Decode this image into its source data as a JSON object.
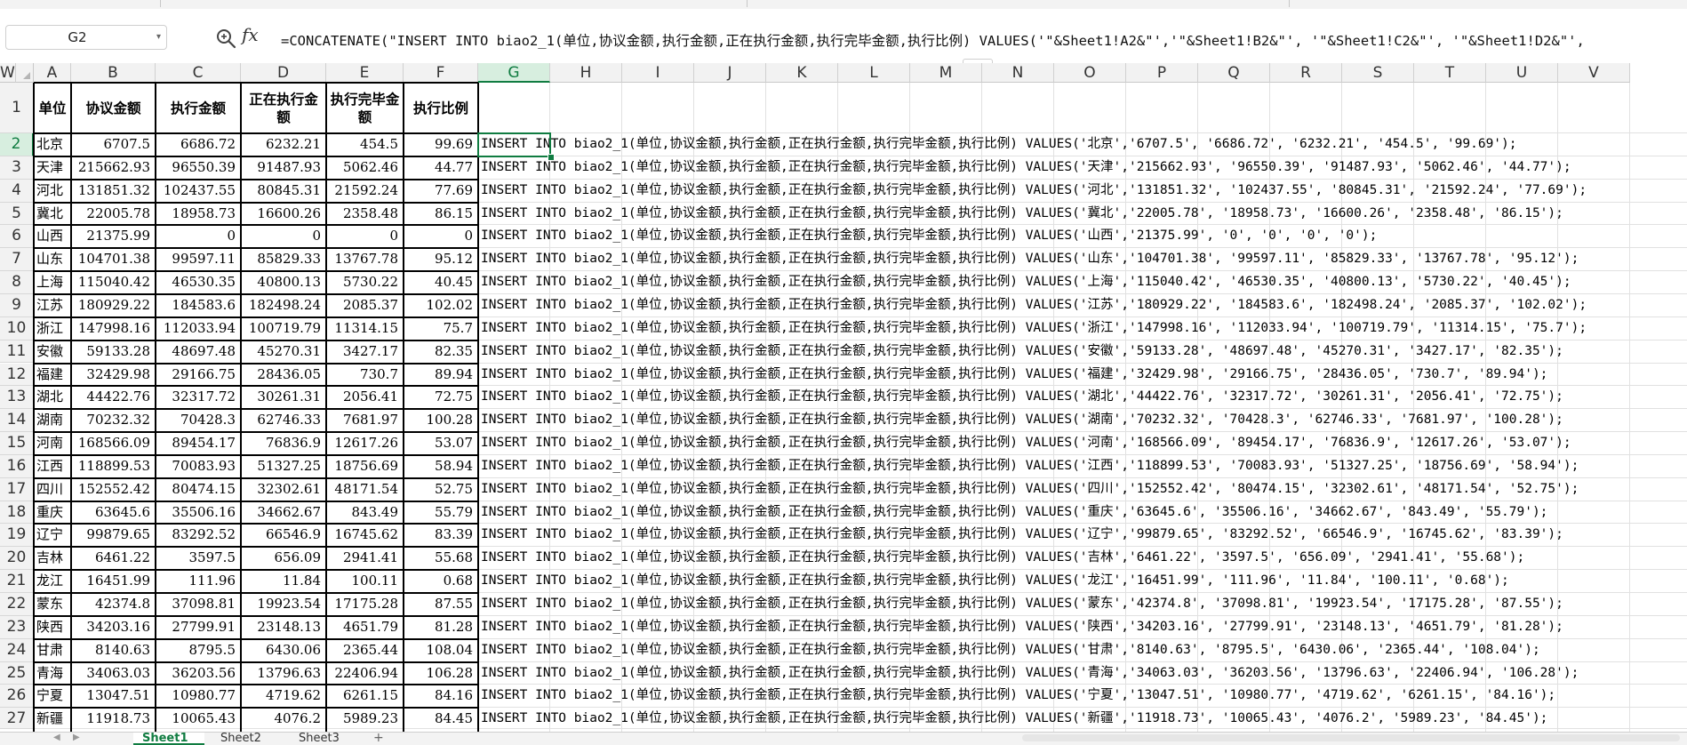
{
  "formula_bar": {
    "name_box": "G2",
    "fx_label": "fx",
    "formula": "=CONCATENATE(\"INSERT INTO biao2_1(单位,协议金额,执行金额,正在执行金额,执行完毕金额,执行比例) VALUES('\"&Sheet1!A2&\"','\"&Sheet1!B2&\"', '\"&Sheet1!C2&\"', '\"&Sheet1!D2&\"',"
  },
  "columns": [
    "A",
    "B",
    "C",
    "D",
    "E",
    "F",
    "G",
    "H",
    "I",
    "J",
    "K",
    "L",
    "M",
    "N",
    "O",
    "P",
    "Q",
    "R",
    "S",
    "T",
    "U",
    "V",
    "W"
  ],
  "active_column": "G",
  "active_row": 2,
  "headers": [
    "单位",
    "协议金额",
    "执行金额",
    "正在执行金额",
    "执行完毕金额",
    "执行比例"
  ],
  "rows": [
    {
      "unit": "北京",
      "b": "6707.5",
      "c": "6686.72",
      "d": "6232.21",
      "e": "454.5",
      "f": "99.69",
      "g": "INSERT INTO biao2_1(单位,协议金额,执行金额,正在执行金额,执行完毕金额,执行比例) VALUES('北京','6707.5', '6686.72', '6232.21', '454.5', '99.69');"
    },
    {
      "unit": "天津",
      "b": "215662.93",
      "c": "96550.39",
      "d": "91487.93",
      "e": "5062.46",
      "f": "44.77",
      "g": "INSERT INTO biao2_1(单位,协议金额,执行金额,正在执行金额,执行完毕金额,执行比例) VALUES('天津','215662.93', '96550.39', '91487.93', '5062.46', '44.77');"
    },
    {
      "unit": "河北",
      "b": "131851.32",
      "c": "102437.55",
      "d": "80845.31",
      "e": "21592.24",
      "f": "77.69",
      "g": "INSERT INTO biao2_1(单位,协议金额,执行金额,正在执行金额,执行完毕金额,执行比例) VALUES('河北','131851.32', '102437.55', '80845.31', '21592.24', '77.69');"
    },
    {
      "unit": "冀北",
      "b": "22005.78",
      "c": "18958.73",
      "d": "16600.26",
      "e": "2358.48",
      "f": "86.15",
      "g": "INSERT INTO biao2_1(单位,协议金额,执行金额,正在执行金额,执行完毕金额,执行比例) VALUES('冀北','22005.78', '18958.73', '16600.26', '2358.48', '86.15');"
    },
    {
      "unit": "山西",
      "b": "21375.99",
      "c": "0",
      "d": "0",
      "e": "0",
      "f": "0",
      "g": "INSERT INTO biao2_1(单位,协议金额,执行金额,正在执行金额,执行完毕金额,执行比例) VALUES('山西','21375.99', '0', '0', '0', '0');"
    },
    {
      "unit": "山东",
      "b": "104701.38",
      "c": "99597.11",
      "d": "85829.33",
      "e": "13767.78",
      "f": "95.12",
      "g": "INSERT INTO biao2_1(单位,协议金额,执行金额,正在执行金额,执行完毕金额,执行比例) VALUES('山东','104701.38', '99597.11', '85829.33', '13767.78', '95.12');"
    },
    {
      "unit": "上海",
      "b": "115040.42",
      "c": "46530.35",
      "d": "40800.13",
      "e": "5730.22",
      "f": "40.45",
      "g": "INSERT INTO biao2_1(单位,协议金额,执行金额,正在执行金额,执行完毕金额,执行比例) VALUES('上海','115040.42', '46530.35', '40800.13', '5730.22', '40.45');"
    },
    {
      "unit": "江苏",
      "b": "180929.22",
      "c": "184583.6",
      "d": "182498.24",
      "e": "2085.37",
      "f": "102.02",
      "g": "INSERT INTO biao2_1(单位,协议金额,执行金额,正在执行金额,执行完毕金额,执行比例) VALUES('江苏','180929.22', '184583.6', '182498.24', '2085.37', '102.02');"
    },
    {
      "unit": "浙江",
      "b": "147998.16",
      "c": "112033.94",
      "d": "100719.79",
      "e": "11314.15",
      "f": "75.7",
      "g": "INSERT INTO biao2_1(单位,协议金额,执行金额,正在执行金额,执行完毕金额,执行比例) VALUES('浙江','147998.16', '112033.94', '100719.79', '11314.15', '75.7');"
    },
    {
      "unit": "安徽",
      "b": "59133.28",
      "c": "48697.48",
      "d": "45270.31",
      "e": "3427.17",
      "f": "82.35",
      "g": "INSERT INTO biao2_1(单位,协议金额,执行金额,正在执行金额,执行完毕金额,执行比例) VALUES('安徽','59133.28', '48697.48', '45270.31', '3427.17', '82.35');"
    },
    {
      "unit": "福建",
      "b": "32429.98",
      "c": "29166.75",
      "d": "28436.05",
      "e": "730.7",
      "f": "89.94",
      "g": "INSERT INTO biao2_1(单位,协议金额,执行金额,正在执行金额,执行完毕金额,执行比例) VALUES('福建','32429.98', '29166.75', '28436.05', '730.7', '89.94');"
    },
    {
      "unit": "湖北",
      "b": "44422.76",
      "c": "32317.72",
      "d": "30261.31",
      "e": "2056.41",
      "f": "72.75",
      "g": "INSERT INTO biao2_1(单位,协议金额,执行金额,正在执行金额,执行完毕金额,执行比例) VALUES('湖北','44422.76', '32317.72', '30261.31', '2056.41', '72.75');"
    },
    {
      "unit": "湖南",
      "b": "70232.32",
      "c": "70428.3",
      "d": "62746.33",
      "e": "7681.97",
      "f": "100.28",
      "g": "INSERT INTO biao2_1(单位,协议金额,执行金额,正在执行金额,执行完毕金额,执行比例) VALUES('湖南','70232.32', '70428.3', '62746.33', '7681.97', '100.28');"
    },
    {
      "unit": "河南",
      "b": "168566.09",
      "c": "89454.17",
      "d": "76836.9",
      "e": "12617.26",
      "f": "53.07",
      "g": "INSERT INTO biao2_1(单位,协议金额,执行金额,正在执行金额,执行完毕金额,执行比例) VALUES('河南','168566.09', '89454.17', '76836.9', '12617.26', '53.07');"
    },
    {
      "unit": "江西",
      "b": "118899.53",
      "c": "70083.93",
      "d": "51327.25",
      "e": "18756.69",
      "f": "58.94",
      "g": "INSERT INTO biao2_1(单位,协议金额,执行金额,正在执行金额,执行完毕金额,执行比例) VALUES('江西','118899.53', '70083.93', '51327.25', '18756.69', '58.94');"
    },
    {
      "unit": "四川",
      "b": "152552.42",
      "c": "80474.15",
      "d": "32302.61",
      "e": "48171.54",
      "f": "52.75",
      "g": "INSERT INTO biao2_1(单位,协议金额,执行金额,正在执行金额,执行完毕金额,执行比例) VALUES('四川','152552.42', '80474.15', '32302.61', '48171.54', '52.75');"
    },
    {
      "unit": "重庆",
      "b": "63645.6",
      "c": "35506.16",
      "d": "34662.67",
      "e": "843.49",
      "f": "55.79",
      "g": "INSERT INTO biao2_1(单位,协议金额,执行金额,正在执行金额,执行完毕金额,执行比例) VALUES('重庆','63645.6', '35506.16', '34662.67', '843.49', '55.79');"
    },
    {
      "unit": "辽宁",
      "b": "99879.65",
      "c": "83292.52",
      "d": "66546.9",
      "e": "16745.62",
      "f": "83.39",
      "g": "INSERT INTO biao2_1(单位,协议金额,执行金额,正在执行金额,执行完毕金额,执行比例) VALUES('辽宁','99879.65', '83292.52', '66546.9', '16745.62', '83.39');"
    },
    {
      "unit": "吉林",
      "b": "6461.22",
      "c": "3597.5",
      "d": "656.09",
      "e": "2941.41",
      "f": "55.68",
      "g": "INSERT INTO biao2_1(单位,协议金额,执行金额,正在执行金额,执行完毕金额,执行比例) VALUES('吉林','6461.22', '3597.5', '656.09', '2941.41', '55.68');"
    },
    {
      "unit": "龙江",
      "b": "16451.99",
      "c": "111.96",
      "d": "11.84",
      "e": "100.11",
      "f": "0.68",
      "g": "INSERT INTO biao2_1(单位,协议金额,执行金额,正在执行金额,执行完毕金额,执行比例) VALUES('龙江','16451.99', '111.96', '11.84', '100.11', '0.68');"
    },
    {
      "unit": "蒙东",
      "b": "42374.8",
      "c": "37098.81",
      "d": "19923.54",
      "e": "17175.28",
      "f": "87.55",
      "g": "INSERT INTO biao2_1(单位,协议金额,执行金额,正在执行金额,执行完毕金额,执行比例) VALUES('蒙东','42374.8', '37098.81', '19923.54', '17175.28', '87.55');"
    },
    {
      "unit": "陕西",
      "b": "34203.16",
      "c": "27799.91",
      "d": "23148.13",
      "e": "4651.79",
      "f": "81.28",
      "g": "INSERT INTO biao2_1(单位,协议金额,执行金额,正在执行金额,执行完毕金额,执行比例) VALUES('陕西','34203.16', '27799.91', '23148.13', '4651.79', '81.28');"
    },
    {
      "unit": "甘肃",
      "b": "8140.63",
      "c": "8795.5",
      "d": "6430.06",
      "e": "2365.44",
      "f": "108.04",
      "g": "INSERT INTO biao2_1(单位,协议金额,执行金额,正在执行金额,执行完毕金额,执行比例) VALUES('甘肃','8140.63', '8795.5', '6430.06', '2365.44', '108.04');"
    },
    {
      "unit": "青海",
      "b": "34063.03",
      "c": "36203.56",
      "d": "13796.63",
      "e": "22406.94",
      "f": "106.28",
      "g": "INSERT INTO biao2_1(单位,协议金额,执行金额,正在执行金额,执行完毕金额,执行比例) VALUES('青海','34063.03', '36203.56', '13796.63', '22406.94', '106.28');"
    },
    {
      "unit": "宁夏",
      "b": "13047.51",
      "c": "10980.77",
      "d": "4719.62",
      "e": "6261.15",
      "f": "84.16",
      "g": "INSERT INTO biao2_1(单位,协议金额,执行金额,正在执行金额,执行完毕金额,执行比例) VALUES('宁夏','13047.51', '10980.77', '4719.62', '6261.15', '84.16');"
    },
    {
      "unit": "新疆",
      "b": "11918.73",
      "c": "10065.43",
      "d": "4076.2",
      "e": "5989.23",
      "f": "84.45",
      "g": "INSERT INTO biao2_1(单位,协议金额,执行金额,正在执行金额,执行完毕金额,执行比例) VALUES('新疆','11918.73', '10065.43', '4076.2', '5989.23', '84.45');"
    }
  ],
  "sheet_tabs": [
    "Sheet1",
    "Sheet2",
    "Sheet3"
  ],
  "active_sheet": "Sheet1",
  "add_sheet_label": "+",
  "colors": {
    "accent": "#107c41",
    "header_bg": "#f2f2f2",
    "gridline": "#e1e1e1",
    "border": "#000000"
  }
}
